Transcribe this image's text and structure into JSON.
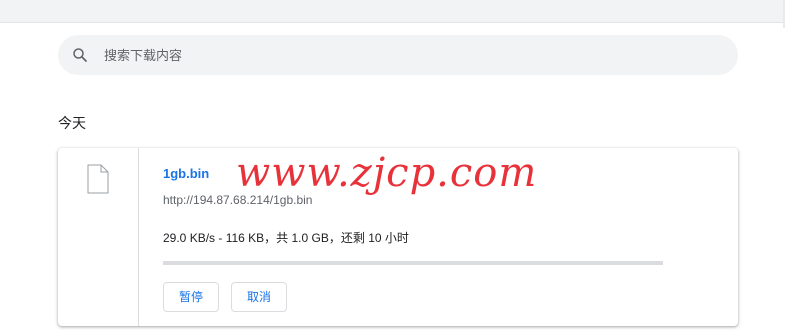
{
  "search": {
    "placeholder": "搜索下载内容",
    "value": ""
  },
  "section": {
    "date_label": "今天"
  },
  "download": {
    "file_name": "1gb.bin",
    "url": "http://194.87.68.214/1gb.bin",
    "status": "29.0 KB/s - 116 KB，共 1.0 GB，还剩 10 小时",
    "progress_fraction": 0.000113,
    "pause_label": "暂停",
    "cancel_label": "取消"
  },
  "watermark": {
    "text": "www.zjcp.com"
  },
  "colors": {
    "accent": "#1a73e8",
    "watermark": "#e8323a"
  },
  "icons": {
    "search": "search-icon",
    "file": "file-icon"
  }
}
